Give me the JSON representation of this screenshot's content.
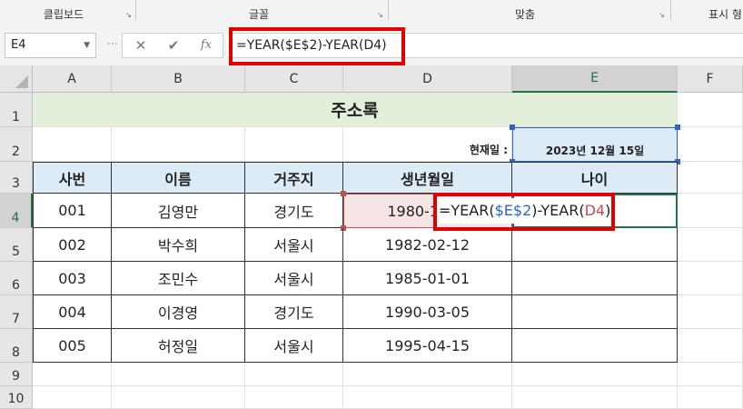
{
  "ribbon": {
    "groups": [
      "클립보드",
      "글꼴",
      "맞춤",
      "표시 형"
    ],
    "launcher": "↘"
  },
  "formula_bar": {
    "name_box": "E4",
    "cancel_glyph": "✕",
    "enter_glyph": "✔",
    "fx_label": "fx",
    "formula": "=YEAR($E$2)-YEAR(D4)"
  },
  "columns": [
    "A",
    "B",
    "C",
    "D",
    "E",
    "F"
  ],
  "rows": [
    "1",
    "2",
    "3",
    "4",
    "5",
    "6",
    "7",
    "8",
    "9",
    "10"
  ],
  "sheet": {
    "title": "주소록",
    "date_label": "현재일 :",
    "date_value": "2023년 12월 15일",
    "headers": [
      "사번",
      "이름",
      "거주지",
      "생년월일",
      "나이"
    ],
    "records": [
      {
        "id": "001",
        "name": "김영만",
        "region": "경기도",
        "birth": "1980-1"
      },
      {
        "id": "002",
        "name": "박수희",
        "region": "서울시",
        "birth": "1982-02-12"
      },
      {
        "id": "003",
        "name": "조민수",
        "region": "서울시",
        "birth": "1985-01-01"
      },
      {
        "id": "004",
        "name": "이경영",
        "region": "경기도",
        "birth": "1990-03-05"
      },
      {
        "id": "005",
        "name": "허정일",
        "region": "서울시",
        "birth": "1995-04-15"
      }
    ],
    "edit_formula": {
      "prefix": "=YEAR(",
      "ref1": "$E$2",
      "middle": ")-YEAR(",
      "ref2": "D4",
      "suffix": ")"
    }
  },
  "colors": {
    "title_fill": "#e2efda",
    "header_fill": "#ddebf7",
    "highlight_red": "#e00000",
    "ref_blue": "#2f63c5",
    "ref_red": "#c0504d",
    "selection_green": "#217346"
  }
}
